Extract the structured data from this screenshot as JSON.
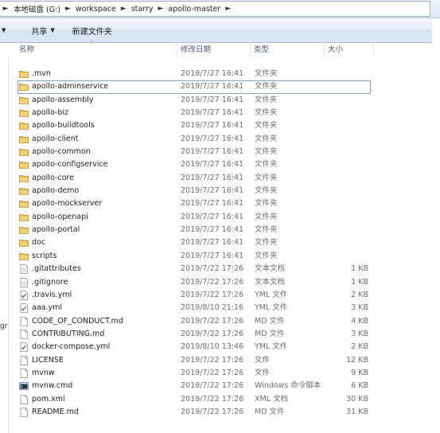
{
  "breadcrumb": {
    "segments": [
      "本地磁盘 (G:)",
      "workspace",
      "starry",
      "apollo-master"
    ]
  },
  "toolbar": {
    "share_label": "共享",
    "new_folder_label": "新建文件夹"
  },
  "columns": {
    "name": "名称",
    "date": "修改日期",
    "type": "类型",
    "size": "大小"
  },
  "left_pane": {
    "fragment": "gr"
  },
  "files": [
    {
      "name": ".mvn",
      "date": "2019/7/27 16:41",
      "type": "文件夹",
      "size": "",
      "icon": "folder-icon"
    },
    {
      "name": "apollo-adminservice",
      "date": "2019/7/27 16:41",
      "type": "文件夹",
      "size": "",
      "icon": "folder-icon"
    },
    {
      "name": "apollo-assembly",
      "date": "2019/7/27 16:41",
      "type": "文件夹",
      "size": "",
      "icon": "folder-icon"
    },
    {
      "name": "apollo-biz",
      "date": "2019/7/27 16:41",
      "type": "文件夹",
      "size": "",
      "icon": "folder-icon"
    },
    {
      "name": "apollo-buildtools",
      "date": "2019/7/27 16:41",
      "type": "文件夹",
      "size": "",
      "icon": "folder-icon"
    },
    {
      "name": "apollo-client",
      "date": "2019/7/27 16:41",
      "type": "文件夹",
      "size": "",
      "icon": "folder-icon"
    },
    {
      "name": "apollo-common",
      "date": "2019/7/27 16:41",
      "type": "文件夹",
      "size": "",
      "icon": "folder-icon"
    },
    {
      "name": "apollo-configservice",
      "date": "2019/7/27 16:41",
      "type": "文件夹",
      "size": "",
      "icon": "folder-icon"
    },
    {
      "name": "apollo-core",
      "date": "2019/7/27 16:41",
      "type": "文件夹",
      "size": "",
      "icon": "folder-icon"
    },
    {
      "name": "apollo-demo",
      "date": "2019/7/27 16:41",
      "type": "文件夹",
      "size": "",
      "icon": "folder-icon"
    },
    {
      "name": "apollo-mockserver",
      "date": "2019/7/27 16:41",
      "type": "文件夹",
      "size": "",
      "icon": "folder-icon"
    },
    {
      "name": "apollo-openapi",
      "date": "2019/7/27 16:41",
      "type": "文件夹",
      "size": "",
      "icon": "folder-icon"
    },
    {
      "name": "apollo-portal",
      "date": "2019/7/27 16:41",
      "type": "文件夹",
      "size": "",
      "icon": "folder-icon"
    },
    {
      "name": "doc",
      "date": "2019/7/27 16:41",
      "type": "文件夹",
      "size": "",
      "icon": "folder-icon"
    },
    {
      "name": "scripts",
      "date": "2019/7/27 16:41",
      "type": "文件夹",
      "size": "",
      "icon": "folder-icon"
    },
    {
      "name": ".gitattributes",
      "date": "2019/7/22 17:26",
      "type": "文本文档",
      "size": "1 KB",
      "icon": "text-file-icon"
    },
    {
      "name": ".gitignore",
      "date": "2019/7/22 17:26",
      "type": "文本文档",
      "size": "1 KB",
      "icon": "text-file-icon"
    },
    {
      "name": ".travis.yml",
      "date": "2019/7/22 17:26",
      "type": "YML 文件",
      "size": "2 KB",
      "icon": "yml-file-icon"
    },
    {
      "name": "aaa.yml",
      "date": "2019/8/10 21:16",
      "type": "YML 文件",
      "size": "3 KB",
      "icon": "yml-file-icon"
    },
    {
      "name": "CODE_OF_CONDUCT.md",
      "date": "2019/7/22 17:26",
      "type": "MD 文件",
      "size": "4 KB",
      "icon": "blank-file-icon"
    },
    {
      "name": "CONTRIBUTING.md",
      "date": "2019/7/22 17:26",
      "type": "MD 文件",
      "size": "3 KB",
      "icon": "blank-file-icon"
    },
    {
      "name": "docker-compose.yml",
      "date": "2019/8/10 13:46",
      "type": "YML 文件",
      "size": "2 KB",
      "icon": "yml-file-icon"
    },
    {
      "name": "LICENSE",
      "date": "2019/7/22 17:26",
      "type": "文件",
      "size": "12 KB",
      "icon": "blank-file-icon"
    },
    {
      "name": "mvnw",
      "date": "2019/7/22 17:26",
      "type": "文件",
      "size": "9 KB",
      "icon": "blank-file-icon"
    },
    {
      "name": "mvnw.cmd",
      "date": "2019/7/22 17:26",
      "type": "Windows 命令脚本",
      "size": "6 KB",
      "icon": "cmd-file-icon"
    },
    {
      "name": "pom.xml",
      "date": "2019/7/22 17:26",
      "type": "XML 文档",
      "size": "30 KB",
      "icon": "blank-file-icon"
    },
    {
      "name": "README.md",
      "date": "2019/7/22 17:26",
      "type": "MD 文件",
      "size": "31 KB",
      "icon": "blank-file-icon"
    }
  ],
  "colors": {
    "folder": "#e8b84a",
    "focus_outline": "#7da2ce",
    "header_text": "#4c607a",
    "meta_text": "#6d6d6d"
  }
}
